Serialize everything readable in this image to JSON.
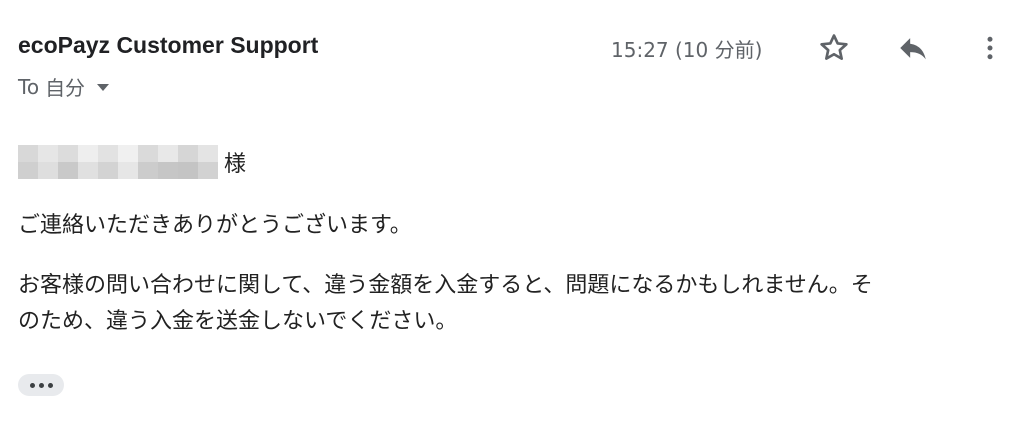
{
  "header": {
    "sender": "ecoPayz Customer Support",
    "to_label": "To",
    "recipient": "自分",
    "timestamp": "15:27 (10 分前)"
  },
  "icons": {
    "star": "star-icon",
    "reply": "reply-icon",
    "more": "more-vert-icon",
    "expand": "more-horiz-icon"
  },
  "message": {
    "honorific": "様",
    "line1": "ご連絡いただきありがとうございます。",
    "line2": "お客様の問い合わせに関して、違う金額を入金すると、問題になるかもしれません。そ",
    "line3": "のため、違う入金を送金しないでください。"
  },
  "colors": {
    "sender_text": "#202124",
    "secondary_text": "#5f6368",
    "body_text": "#222222",
    "chip_bg": "#e8eaed"
  }
}
